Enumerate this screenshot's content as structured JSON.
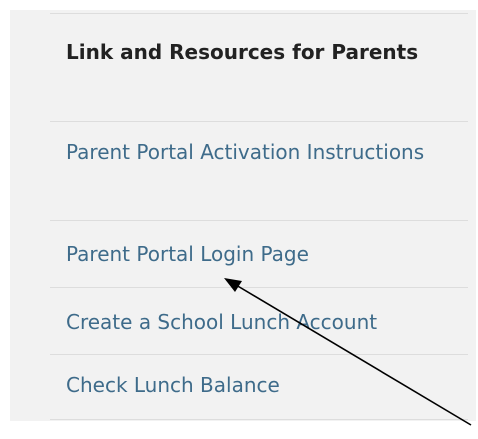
{
  "sidebar": {
    "heading": "Link and Resources for Parents",
    "links": [
      {
        "label": "Parent Portal Activation Instructions"
      },
      {
        "label": "Parent Portal Login Page"
      },
      {
        "label": "Create a School Lunch Account"
      },
      {
        "label": "Check Lunch Balance"
      }
    ]
  },
  "annotation": {
    "arrow_color": "#000000"
  }
}
